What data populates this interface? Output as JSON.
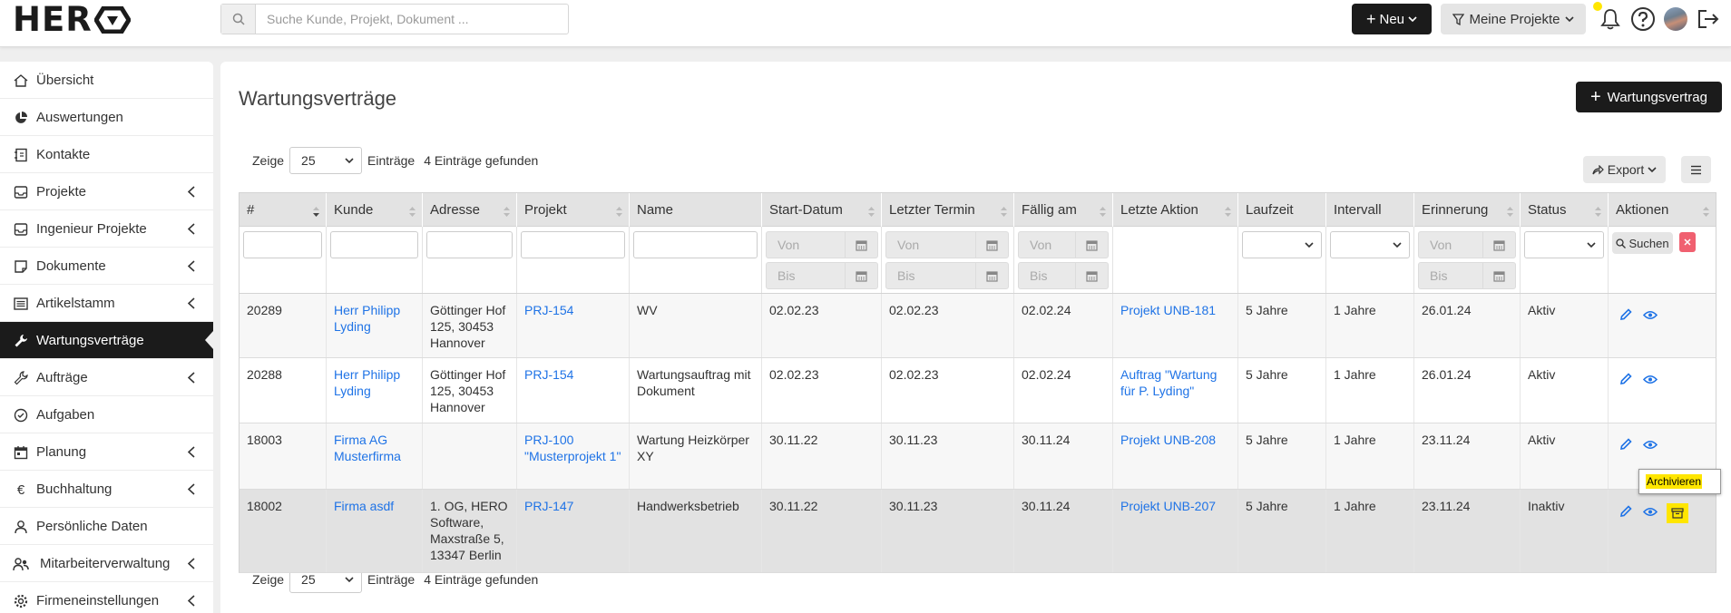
{
  "app": {
    "logo_text": "HER",
    "search_placeholder": "Suche Kunde, Projekt, Dokument ...",
    "new_button": "Neu",
    "filter_button": "Meine Projekte"
  },
  "sidebar": {
    "items": [
      {
        "label": "Übersicht",
        "icon": "home-icon",
        "chevron": false,
        "active": false
      },
      {
        "label": "Auswertungen",
        "icon": "pie-chart-icon",
        "chevron": false,
        "active": false
      },
      {
        "label": "Kontakte",
        "icon": "address-book-icon",
        "chevron": false,
        "active": false
      },
      {
        "label": "Projekte",
        "icon": "inbox-icon",
        "chevron": true,
        "active": false
      },
      {
        "label": "Ingenieur Projekte",
        "icon": "inbox-icon",
        "chevron": true,
        "active": false
      },
      {
        "label": "Dokumente",
        "icon": "note-icon",
        "chevron": true,
        "active": false
      },
      {
        "label": "Artikelstamm",
        "icon": "list-icon",
        "chevron": true,
        "active": false
      },
      {
        "label": "Wartungsverträge",
        "icon": "wrench-icon",
        "chevron": false,
        "active": true
      },
      {
        "label": "Aufträge",
        "icon": "tools-icon",
        "chevron": true,
        "active": false
      },
      {
        "label": "Aufgaben",
        "icon": "check-circle-icon",
        "chevron": false,
        "active": false
      },
      {
        "label": "Planung",
        "icon": "calendar-icon",
        "chevron": true,
        "active": false
      },
      {
        "label": "Buchhaltung",
        "icon": "euro-icon",
        "chevron": true,
        "active": false
      },
      {
        "label": "Persönliche Daten",
        "icon": "user-icon",
        "chevron": false,
        "active": false
      },
      {
        "label": "Mitarbeiterverwaltung",
        "icon": "users-icon",
        "chevron": true,
        "active": false
      },
      {
        "label": "Firmeneinstellungen",
        "icon": "gear-icon",
        "chevron": true,
        "active": false
      }
    ]
  },
  "main": {
    "title": "Wartungsverträge",
    "add_button": "Wartungsvertrag",
    "length_label_pre": "Zeige",
    "length_value": "25",
    "length_label_post": "Einträge",
    "found_text": "4 Einträge gefunden",
    "export_button": "Export"
  },
  "table": {
    "columns": [
      "#",
      "Kunde",
      "Adresse",
      "Projekt",
      "Name",
      "Start-Datum",
      "Letzter Termin",
      "Fällig am",
      "Letzte Aktion",
      "Laufzeit",
      "Intervall",
      "Erinnerung",
      "Status",
      "Aktionen"
    ],
    "filters": {
      "von": "Von",
      "bis": "Bis",
      "search_button": "Suchen"
    },
    "rows": [
      {
        "id": "20289",
        "kunde": "Herr Philipp Lyding",
        "adresse": "Göttinger Hof 125, 30453 Hannover",
        "projekt": "PRJ-154",
        "name": "WV",
        "start": "02.02.23",
        "letzter": "02.02.23",
        "faellig": "02.02.24",
        "aktion": "Projekt UNB-181",
        "laufzeit": "5 Jahre",
        "intervall": "1 Jahre",
        "erinnerung": "26.01.24",
        "status": "Aktiv"
      },
      {
        "id": "20288",
        "kunde": "Herr Philipp Lyding",
        "adresse": "Göttinger Hof 125, 30453 Hannover",
        "projekt": "PRJ-154",
        "name": "Wartungsauftrag mit Dokument",
        "start": "02.02.23",
        "letzter": "02.02.23",
        "faellig": "02.02.24",
        "aktion": "Auftrag \"Wartung für P. Lyding\"",
        "laufzeit": "5 Jahre",
        "intervall": "1 Jahre",
        "erinnerung": "26.01.24",
        "status": "Aktiv"
      },
      {
        "id": "18003",
        "kunde": "Firma AG Musterfirma",
        "adresse": "",
        "projekt": "PRJ-100 \"Musterprojekt 1\"",
        "name": "Wartung Heizkörper XY",
        "start": "30.11.22",
        "letzter": "30.11.23",
        "faellig": "30.11.24",
        "aktion": "Projekt UNB-208",
        "laufzeit": "5 Jahre",
        "intervall": "1 Jahre",
        "erinnerung": "23.11.24",
        "status": "Aktiv"
      },
      {
        "id": "18002",
        "kunde": "Firma asdf",
        "adresse": "1. OG, HERO Software, Maxstraße 5, 13347 Berlin",
        "projekt": "PRJ-147",
        "name": "Handwerksbetrieb",
        "start": "30.11.22",
        "letzter": "30.11.23",
        "faellig": "30.11.24",
        "aktion": "Projekt UNB-207",
        "laufzeit": "5 Jahre",
        "intervall": "1 Jahre",
        "erinnerung": "23.11.24",
        "status": "Inaktiv"
      }
    ]
  },
  "tooltip": "Archivieren",
  "colors": {
    "accent_dark": "#1b1b1b",
    "link": "#1f73e6",
    "highlight": "#ffe600",
    "danger": "#f06070"
  }
}
